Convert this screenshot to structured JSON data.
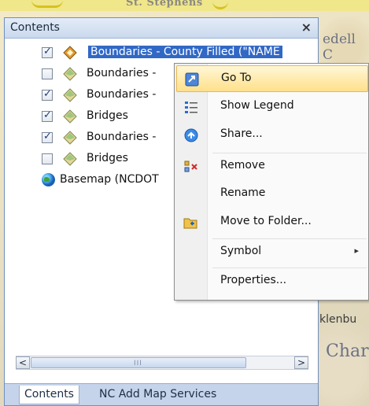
{
  "map": {
    "top_label": "St. Stephens",
    "side_labels": [
      "edell C",
      "klenbu",
      "Char"
    ]
  },
  "panel": {
    "title": "Contents",
    "close_glyph": "×",
    "layers": [
      {
        "label": "Boundaries - County Filled (\"NAME",
        "checked": true,
        "selected": true,
        "icon": "polygon-layer-icon"
      },
      {
        "label": "Boundaries -",
        "checked": false,
        "selected": false,
        "icon": "polygon-layer-icon"
      },
      {
        "label": "Boundaries -",
        "checked": true,
        "selected": false,
        "icon": "polygon-layer-icon"
      },
      {
        "label": "Bridges",
        "checked": true,
        "selected": false,
        "icon": "polygon-layer-icon"
      },
      {
        "label": "Boundaries -",
        "checked": true,
        "selected": false,
        "icon": "polygon-layer-icon"
      },
      {
        "label": "Bridges",
        "checked": false,
        "selected": false,
        "icon": "polygon-layer-icon"
      },
      {
        "label": "Basemap (NCDOT",
        "checked": null,
        "selected": false,
        "icon": "globe-icon"
      }
    ],
    "scroll_left": "<",
    "scroll_right": ">",
    "scroll_grip": "III"
  },
  "tabs": [
    {
      "label": "Contents",
      "active": true
    },
    {
      "label": "NC Add Map Services",
      "active": false
    }
  ],
  "context_menu": {
    "items": [
      {
        "label": "Go To",
        "icon": "goto-icon",
        "hover": true
      },
      {
        "label": "Show Legend",
        "icon": "legend-icon"
      },
      {
        "label": "Share...",
        "icon": "share-icon"
      },
      {
        "label": "Remove",
        "icon": "remove-icon"
      },
      {
        "label": "Rename",
        "icon": ""
      },
      {
        "label": "Move to Folder...",
        "icon": "folder-move-icon"
      },
      {
        "label": "Symbol",
        "icon": "",
        "submenu": true
      },
      {
        "label": "Properties...",
        "icon": ""
      }
    ],
    "submenu_arrow": "▸"
  }
}
